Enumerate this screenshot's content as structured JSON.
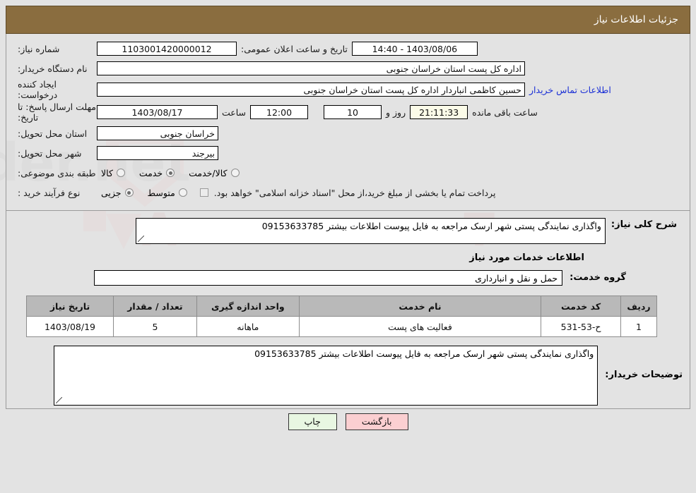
{
  "header": {
    "title": "جزئیات اطلاعات نیاز",
    "bg": "#8a6d3f",
    "fg": "#ffffff"
  },
  "watermark": {
    "text": "AriaTender.net"
  },
  "form": {
    "need_number": {
      "label": "شماره نیاز:",
      "value": "1103001420000012"
    },
    "public_announce": {
      "label": "تاریخ و ساعت اعلان عمومی:",
      "value": "1403/08/06 - 14:40"
    },
    "buyer_org": {
      "label": "نام دستگاه خریدار:",
      "value": "اداره کل پست استان خراسان جنوبی"
    },
    "requester": {
      "label": "ایجاد کننده درخواست:",
      "value": "حسین کاظمی انباردار اداره کل پست استان خراسان جنوبی"
    },
    "buyer_contact_link": "اطلاعات تماس خریدار",
    "deadline": {
      "label": "مهلت ارسال پاسخ: تا تاریخ:",
      "date": "1403/08/17",
      "hour_label": "ساعت",
      "hour": "12:00",
      "days": "10",
      "days_label": "روز و",
      "timer": "21:11:33",
      "timer_label": "ساعت باقی مانده"
    },
    "province": {
      "label": "استان محل تحویل:",
      "value": "خراسان جنوبی"
    },
    "city": {
      "label": "شهر محل تحویل:",
      "value": "بیرجند"
    },
    "classification": {
      "label": "طبقه بندی موضوعی:",
      "options": [
        {
          "label": "کالا",
          "selected": false
        },
        {
          "label": "خدمت",
          "selected": true
        },
        {
          "label": "کالا/خدمت",
          "selected": false
        }
      ]
    },
    "purchase_type": {
      "label": "نوع فرآیند خرید :",
      "options": [
        {
          "label": "جزیی",
          "selected": true
        },
        {
          "label": "متوسط",
          "selected": false
        }
      ],
      "checkbox_checked": false,
      "checkbox_note": "پرداخت تمام یا بخشی از مبلغ خرید،از محل \"اسناد خزانه اسلامی\" خواهد بود."
    }
  },
  "need_summary": {
    "label": "شرح کلی نیاز:",
    "value": "واگذاری نمایندگی پستی شهر ارسک مراجعه به فایل پیوست اطلاعات بیشتر 09153633785"
  },
  "services": {
    "heading": "اطلاعات خدمات مورد نیاز",
    "group_label": "گروه خدمت:",
    "group_value": "حمل و نقل و انبارداری",
    "columns": [
      "ردیف",
      "کد خدمت",
      "نام خدمت",
      "واحد اندازه گیری",
      "تعداد / مقدار",
      "تاریخ نیاز"
    ],
    "rows": [
      {
        "radif": "1",
        "code": "ح-53-531",
        "name": "فعالیت های پست",
        "unit": "ماهانه",
        "qty": "5",
        "date": "1403/08/19"
      }
    ]
  },
  "buyer_notes": {
    "label": "توضیحات خریدار:",
    "value": "واگذاری نمایندگی پستی شهر ارسک مراجعه به فایل پیوست اطلاعات بیشتر 09153633785"
  },
  "footer": {
    "print_label": "چاپ",
    "back_label": "بازگشت",
    "print_bg": "#e8f7e2",
    "back_bg": "#fbcfd1"
  }
}
